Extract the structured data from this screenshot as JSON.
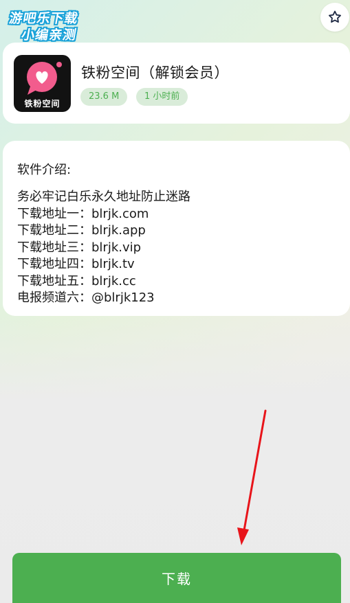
{
  "watermark": {
    "line1": "游吧乐下载",
    "line2": "小编亲测"
  },
  "app": {
    "icon_label": "铁粉空间",
    "name": "铁粉空间（解锁会员）",
    "size": "23.6 M",
    "updated": "1 小时前"
  },
  "intro": {
    "title": "软件介绍:",
    "lines": [
      "务必牢记白乐永久地址防止迷路",
      "下载地址一：blrjk.com",
      "下载地址二：blrjk.app",
      "下载地址三：blrjk.vip",
      "下载地址四：blrjk.tv",
      "下载地址五：blrjk.cc",
      "电报频道六：@blrjk123"
    ]
  },
  "actions": {
    "download_label": "下载"
  },
  "icons": {
    "favorite": "star-outline-icon",
    "app": "heart-chat-bubble-icon"
  },
  "colors": {
    "accent": "#4caf50",
    "tag_background": "#d9ecd9",
    "icon_pink": "#f25c8d",
    "arrow_red": "#e8141a"
  }
}
